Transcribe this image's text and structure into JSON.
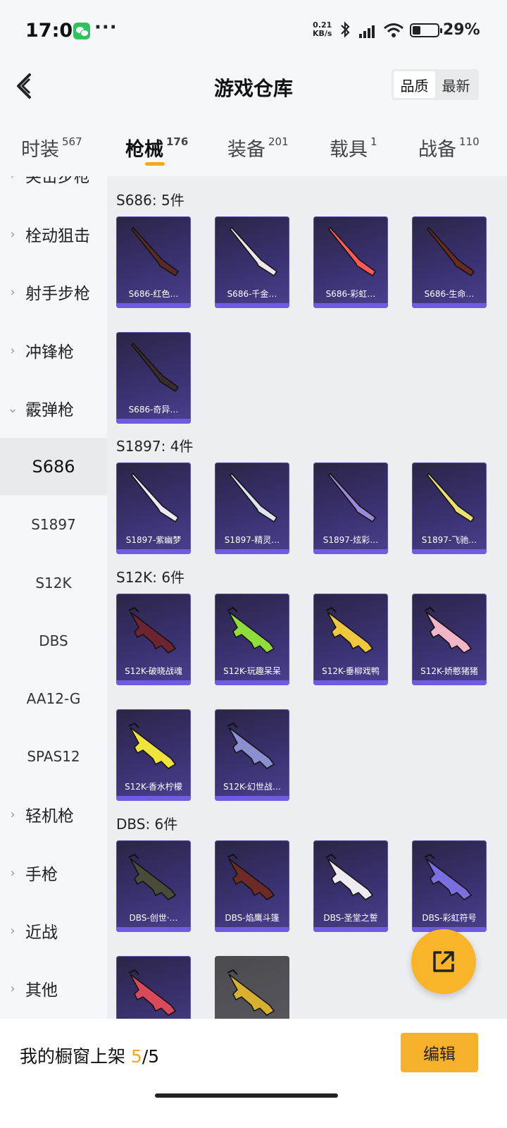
{
  "status": {
    "time": "17:01",
    "net_speed_value": "0.21",
    "net_speed_unit": "KB/s",
    "battery": "29%"
  },
  "header": {
    "title": "游戏仓库",
    "sort_options": [
      "品质",
      "最新"
    ],
    "sort_active": "品质"
  },
  "tabs": [
    {
      "label": "时装",
      "count": "567"
    },
    {
      "label": "枪械",
      "count": "176"
    },
    {
      "label": "装备",
      "count": "201"
    },
    {
      "label": "载具",
      "count": "1"
    },
    {
      "label": "战备",
      "count": "110"
    }
  ],
  "active_tab": "枪械",
  "sidebar": {
    "items": [
      {
        "label": "突击步枪",
        "type": "category"
      },
      {
        "label": "栓动狙击",
        "type": "category"
      },
      {
        "label": "射手步枪",
        "type": "category"
      },
      {
        "label": "冲锋枪",
        "type": "category"
      },
      {
        "label": "霰弹枪",
        "type": "category-expanded"
      },
      {
        "label": "S686",
        "type": "sub-selected"
      },
      {
        "label": "S1897",
        "type": "sub"
      },
      {
        "label": "S12K",
        "type": "sub"
      },
      {
        "label": "DBS",
        "type": "sub"
      },
      {
        "label": "AA12-G",
        "type": "sub"
      },
      {
        "label": "SPAS12",
        "type": "sub"
      },
      {
        "label": "轻机枪",
        "type": "category"
      },
      {
        "label": "手枪",
        "type": "category"
      },
      {
        "label": "近战",
        "type": "category"
      },
      {
        "label": "其他",
        "type": "category"
      }
    ]
  },
  "groups": [
    {
      "title": "S686: 5件",
      "items": [
        "S686-红色…",
        "S686-千金…",
        "S686-彩虹…",
        "S686-生命…",
        "S686-奇异…"
      ]
    },
    {
      "title": "S1897: 4件",
      "items": [
        "S1897-紫幽梦",
        "S1897-精灵…",
        "S1897-炫彩…",
        "S1897-飞驰…"
      ]
    },
    {
      "title": "S12K: 6件",
      "items": [
        "S12K-破晓战魂",
        "S12K-玩趣呆呆",
        "S12K-垂柳戏鸭",
        "S12K-娇憨猪猪",
        "S12K-香水柠檬",
        "S12K-幻世战…"
      ]
    },
    {
      "title": "DBS: 6件",
      "items": [
        "DBS-创世·…",
        "DBS-焰鹰斗篷",
        "DBS-圣堂之誓",
        "DBS-彩虹符号",
        "",
        ""
      ]
    }
  ],
  "colors": {
    "accent": "#f5a623",
    "card_bg": "#3a3170",
    "card_bar": "#6f5ce0"
  },
  "icons": {
    "back": "chevron-left-icon",
    "share": "share-external-icon"
  },
  "footer": {
    "label": "我的橱窗上架",
    "current": "5",
    "total": "/5",
    "edit_label": "编辑"
  }
}
